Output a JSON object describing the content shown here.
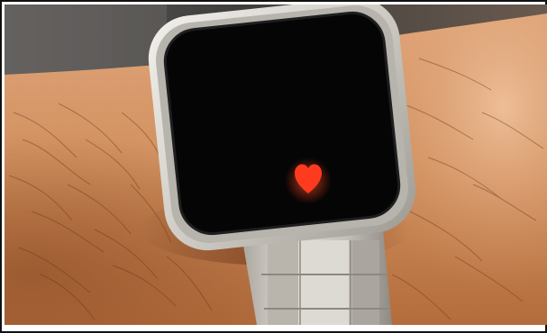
{
  "image": {
    "subject": "smartwatch",
    "screen_icon": "heart-icon",
    "colors": {
      "skin_light": "#e3a676",
      "skin_mid": "#c9824f",
      "skin_shadow": "#8a4a24",
      "background_top": "#4c4a48",
      "case_metal": "#d9d6d1",
      "case_edge": "#a9a6a1",
      "screen": "#050505",
      "heart": "#ff3b1f",
      "band_metal": "#c8c4bd",
      "frame_border": "#111111"
    }
  }
}
